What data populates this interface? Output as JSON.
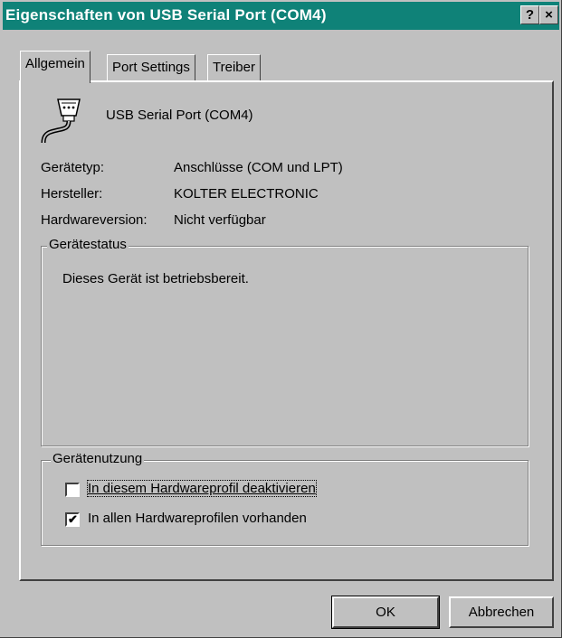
{
  "window": {
    "title": "Eigenschaften von USB Serial Port (COM4)",
    "help_glyph": "?",
    "close_glyph": "×"
  },
  "tabs": [
    {
      "label": "Allgemein"
    },
    {
      "label": "Port Settings"
    },
    {
      "label": "Treiber"
    }
  ],
  "device": {
    "icon": "serial-port-icon",
    "name": "USB Serial Port (COM4)",
    "props": [
      {
        "label": "Gerätetyp:",
        "value": "Anschlüsse (COM und LPT)"
      },
      {
        "label": "Hersteller:",
        "value": "KOLTER ELECTRONIC"
      },
      {
        "label": "Hardwareversion:",
        "value": "Nicht verfügbar"
      }
    ]
  },
  "status": {
    "legend": "Gerätestatus",
    "text": "Dieses Gerät ist betriebsbereit."
  },
  "usage": {
    "legend": "Gerätenutzung",
    "options": [
      {
        "label": "In diesem Hardwareprofil deaktivieren",
        "checked": false
      },
      {
        "label": "In allen Hardwareprofilen vorhanden",
        "checked": true
      }
    ]
  },
  "buttons": {
    "ok": "OK",
    "cancel": "Abbrechen"
  }
}
